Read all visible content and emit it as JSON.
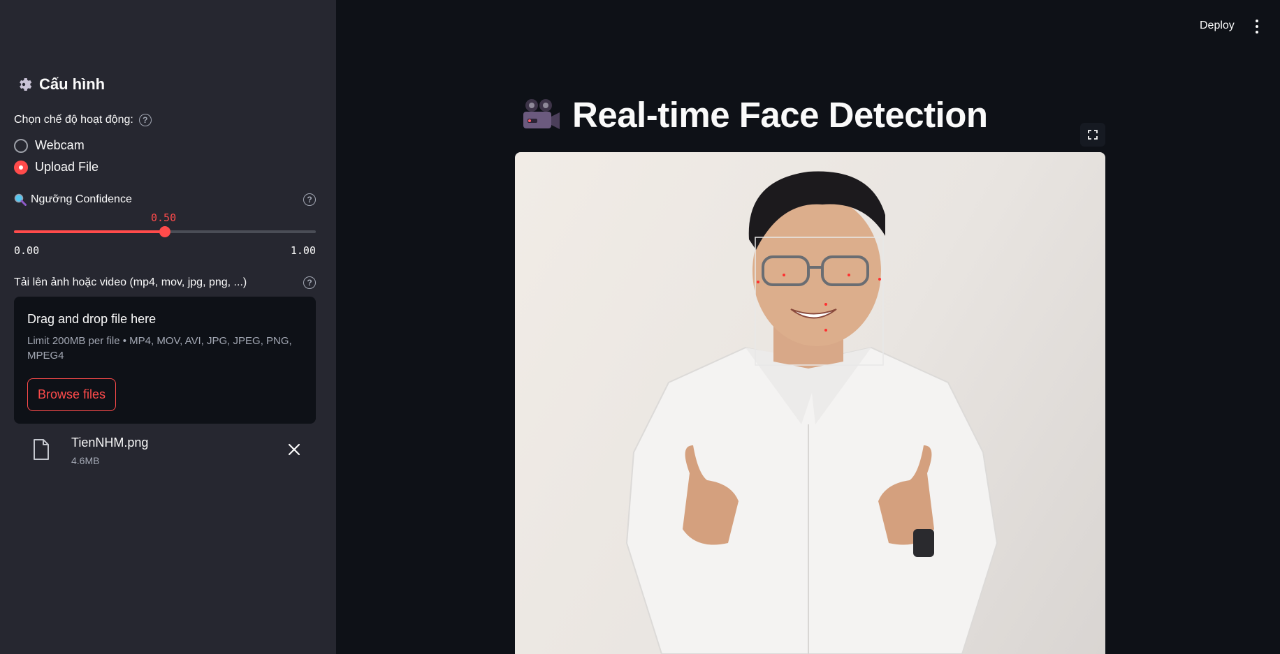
{
  "sidebar": {
    "title": "Cấu hình",
    "mode_label": "Chọn chế độ hoạt động:",
    "modes": [
      {
        "label": "Webcam",
        "selected": false
      },
      {
        "label": "Upload File",
        "selected": true
      }
    ],
    "confidence": {
      "label": "Ngưỡng Confidence",
      "value": "0.50",
      "min": "0.00",
      "max": "1.00",
      "fraction": 0.5
    },
    "upload": {
      "label": "Tải lên ảnh hoặc video (mp4, mov, jpg, png, ...)",
      "drop_title": "Drag and drop file here",
      "drop_sub": "Limit 200MB per file • MP4, MOV, AVI, JPG, JPEG, PNG, MPEG4",
      "browse_label": "Browse files"
    },
    "file": {
      "name": "TienNHM.png",
      "size": "4.6MB"
    }
  },
  "header": {
    "deploy_label": "Deploy"
  },
  "main": {
    "title": "Real-time Face Detection",
    "title_icon": "movie-camera-icon"
  },
  "colors": {
    "accent": "#ff4b4b",
    "sidebar_bg": "#262730",
    "main_bg": "#0e1117"
  }
}
